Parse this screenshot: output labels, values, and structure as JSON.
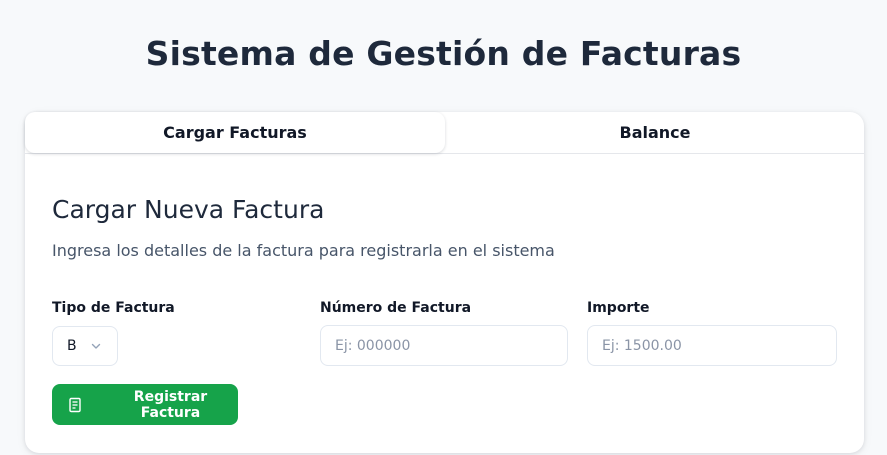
{
  "header": {
    "title": "Sistema de Gestión de Facturas"
  },
  "tabs": [
    {
      "label": "Cargar Facturas",
      "active": true
    },
    {
      "label": "Balance",
      "active": false
    }
  ],
  "form": {
    "title": "Cargar Nueva Factura",
    "subtitle": "Ingresa los detalles de la factura para registrarla en el sistema",
    "tipo": {
      "label": "Tipo de Factura",
      "value": "B",
      "icon": "chevron-down-icon"
    },
    "numero": {
      "label": "Número de Factura",
      "placeholder": "Ej: 000000",
      "value": ""
    },
    "importe": {
      "label": "Importe",
      "placeholder": "Ej: 1500.00",
      "value": ""
    },
    "submit": {
      "label": "Registrar Factura",
      "icon": "document-icon"
    }
  },
  "colors": {
    "accent": "#16a34a",
    "background": "#f7f9fb",
    "card": "#ffffff",
    "title": "#1e293b"
  }
}
